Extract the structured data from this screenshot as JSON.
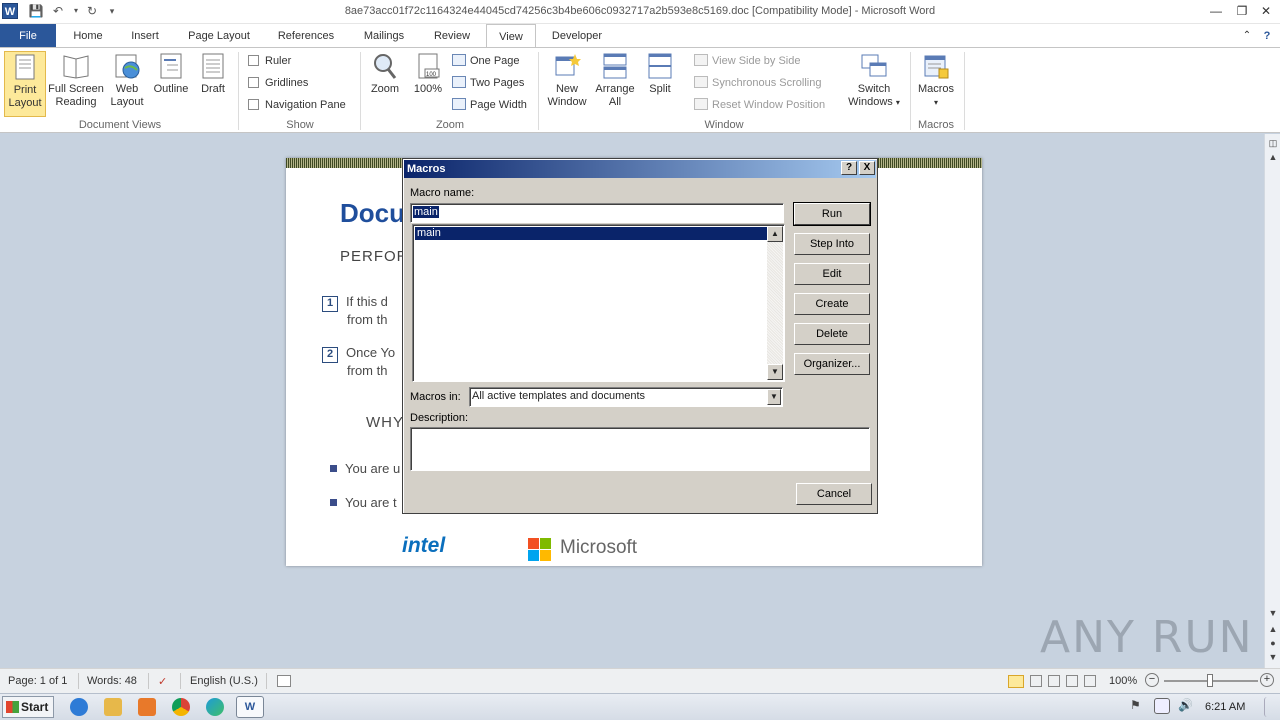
{
  "window": {
    "title": "8ae73acc01f72c1164324e44045cd74256c3b4be606c0932717a2b593e8c5169.doc [Compatibility Mode]  -  Microsoft Word",
    "app_icon": "W"
  },
  "tabs": {
    "file": "File",
    "home": "Home",
    "insert": "Insert",
    "page_layout": "Page Layout",
    "references": "References",
    "mailings": "Mailings",
    "review": "Review",
    "view": "View",
    "developer": "Developer"
  },
  "ribbon": {
    "document_views": {
      "label": "Document Views",
      "print_layout": "Print Layout",
      "full_screen_reading_1": "Full Screen",
      "full_screen_reading_2": "Reading",
      "web_layout_1": "Web",
      "web_layout_2": "Layout",
      "outline": "Outline",
      "draft": "Draft",
      "print_layout_1": "Print",
      "print_layout_2": "Layout"
    },
    "show": {
      "label": "Show",
      "ruler": "Ruler",
      "gridlines": "Gridlines",
      "navigation_pane": "Navigation Pane"
    },
    "zoom": {
      "label": "Zoom",
      "zoom": "Zoom",
      "hundred": "100%",
      "one_page": "One Page",
      "two_pages": "Two Pages",
      "page_width": "Page Width"
    },
    "window": {
      "label": "Window",
      "new_window_1": "New",
      "new_window_2": "Window",
      "arrange_all_1": "Arrange",
      "arrange_all_2": "All",
      "split": "Split",
      "view_side_by_side": "View Side by Side",
      "synchronous_scrolling": "Synchronous Scrolling",
      "reset_window_position": "Reset Window Position",
      "switch_windows_1": "Switch",
      "switch_windows_2": "Windows"
    },
    "macros": {
      "label": "Macros",
      "macros": "Macros"
    }
  },
  "document": {
    "heading": "Docu",
    "perform": "PERFOR",
    "step1_line1": "If this d",
    "step1_line2": "from th",
    "step2_line1": "Once Yo",
    "step2_line2": "from th",
    "step1_num": "1",
    "step2_num": "2",
    "why": "WHY",
    "bullet1": "You are u",
    "bullet2": "You are t",
    "intel": "intel",
    "microsoft": "Microsoft"
  },
  "dialog": {
    "title": "Macros",
    "help": "?",
    "close": "X",
    "macro_name_label": "Macro name:",
    "macro_name_value": "main",
    "macros_list": [
      "main"
    ],
    "macros_in_label": "Macros in:",
    "macros_in_value": "All active templates and documents",
    "description_label": "Description:",
    "buttons": {
      "run": "Run",
      "step_into": "Step Into",
      "edit": "Edit",
      "create": "Create",
      "delete": "Delete",
      "organizer": "Organizer...",
      "cancel": "Cancel"
    }
  },
  "statusbar": {
    "page": "Page: 1 of 1",
    "words": "Words: 48",
    "language": "English (U.S.)",
    "zoom": "100%"
  },
  "taskbar": {
    "start": "Start",
    "clock": "6:21 AM"
  },
  "watermark": "ANY RUN",
  "colors": {
    "accent": "#2b579a",
    "dialog_title": "#0a246a",
    "selection": "#0a246a",
    "ribbon_selected": "#fde99a",
    "doc_background": "#c7d2df"
  }
}
